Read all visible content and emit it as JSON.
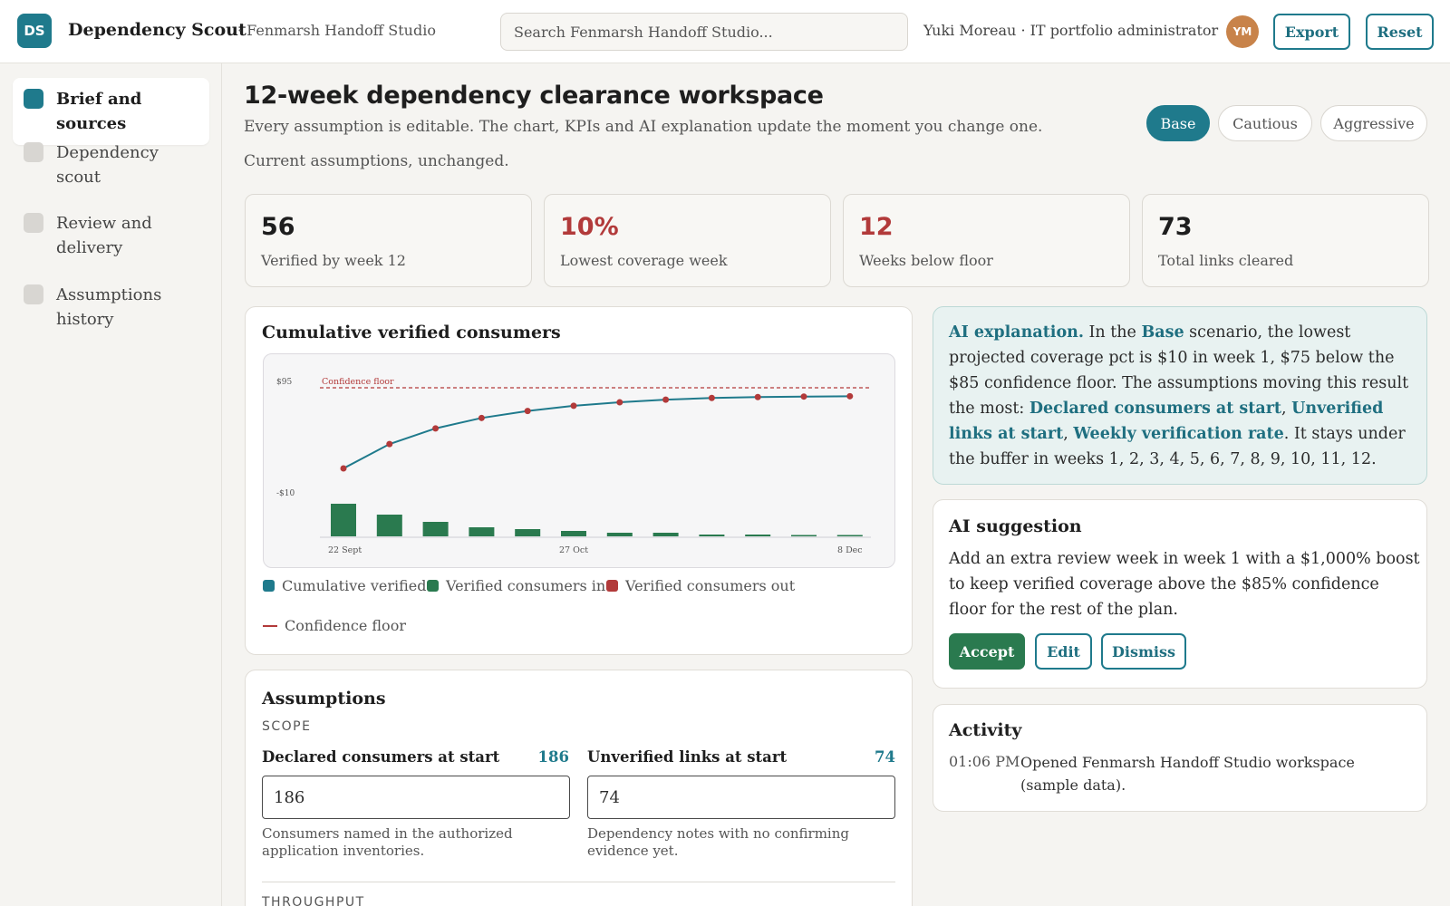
{
  "app": {
    "logo_text": "DS",
    "title": "Dependency Scout",
    "workspace": "· Fenmarsh Handoff Studio",
    "search_placeholder": "Search Fenmarsh Handoff Studio...",
    "user": "Yuki Moreau · IT portfolio administrator",
    "avatar_initials": "YM",
    "export_label": "Export",
    "reset_label": "Reset"
  },
  "sidebar": {
    "items": [
      {
        "label": "Brief and sources",
        "active": true
      },
      {
        "label": "Dependency scout",
        "active": false
      },
      {
        "label": "Review and delivery",
        "active": false
      },
      {
        "label": "Assumptions history",
        "active": false
      }
    ]
  },
  "header": {
    "title": "12-week dependency clearance workspace",
    "subtitle": "Every assumption is editable. The chart, KPIs and AI explanation update the moment you change one.",
    "status": "Current assumptions, unchanged.",
    "scenarios": [
      "Base",
      "Cautious",
      "Aggressive"
    ],
    "active_scenario": "Base"
  },
  "kpis": [
    {
      "value": "56",
      "label": "Verified by week 12",
      "color": "#1e1e1e"
    },
    {
      "value": "10%",
      "label": "Lowest coverage week",
      "color": "#b23a3a"
    },
    {
      "value": "12",
      "label": "Weeks below floor",
      "color": "#b23a3a"
    },
    {
      "value": "73",
      "label": "Total links cleared",
      "color": "#1e1e1e"
    }
  ],
  "chart_panel": {
    "title": "Cumulative verified consumers",
    "legend": {
      "cumulative": "Cumulative verified",
      "in": "Verified consumers in",
      "out": "Verified consumers out",
      "floor": "Confidence floor"
    }
  },
  "chart_data": {
    "type": "line",
    "x_tick_labels": [
      "22 Sept",
      "27 Oct",
      "8 Dec"
    ],
    "y_tick_labels": [
      "$95",
      "-$10"
    ],
    "floor_label": "Confidence floor",
    "weeks": [
      1,
      2,
      3,
      4,
      5,
      6,
      7,
      8,
      9,
      10,
      11,
      12
    ],
    "series": [
      {
        "name": "Cumulative verified",
        "type": "line",
        "color": "#1f7a8c",
        "values": [
          10,
          24,
          33,
          39,
          43,
          46,
          48,
          49.5,
          50.5,
          51,
          51.3,
          51.5
        ]
      },
      {
        "name": "Verified consumers in",
        "type": "bar",
        "color": "#2a7a4f",
        "values": [
          18,
          12,
          8,
          5,
          4,
          3,
          2,
          2,
          1,
          1,
          0.5,
          0.5
        ]
      }
    ],
    "confidence_floor": 85,
    "colors": {
      "floor": "#b23a3a",
      "points": "#b23a3a"
    }
  },
  "ai_explanation": {
    "heading": "AI explanation.",
    "t1": " In the ",
    "scenario": "Base",
    "t2": " scenario, the lowest projected coverage pct is $10 in week 1, $75 below the $85 confidence floor. The assumptions moving this result the most: ",
    "a1": "Declared consumers at start",
    "sep1": ", ",
    "a2": "Unverified links at start",
    "sep2": ", ",
    "a3": "Weekly verification rate",
    "t3": ". It stays under the buffer in weeks 1, 2, 3, 4, 5, 6, 7, 8, 9, 10, 11, 12."
  },
  "ai_suggestion": {
    "title": "AI suggestion",
    "text": "Add an extra review week in week 1 with a $1,000% boost to keep verified coverage above the $85% confidence floor for the rest of the plan.",
    "accept": "Accept",
    "edit": "Edit",
    "dismiss": "Dismiss"
  },
  "activity": {
    "title": "Activity",
    "entries": [
      {
        "time": "01:06 PM",
        "text": "Opened Fenmarsh Handoff Studio workspace (sample data)."
      }
    ]
  },
  "assumptions": {
    "title": "Assumptions",
    "scope_label": "SCOPE",
    "throughput_label": "THROUGHPUT",
    "fields": [
      {
        "label": "Declared consumers at start",
        "value": "186",
        "input": "186",
        "help": "Consumers named in the authorized application inventories."
      },
      {
        "label": "Unverified links at start",
        "value": "74",
        "input": "74",
        "help": "Dependency notes with no confirming evidence yet."
      }
    ]
  }
}
